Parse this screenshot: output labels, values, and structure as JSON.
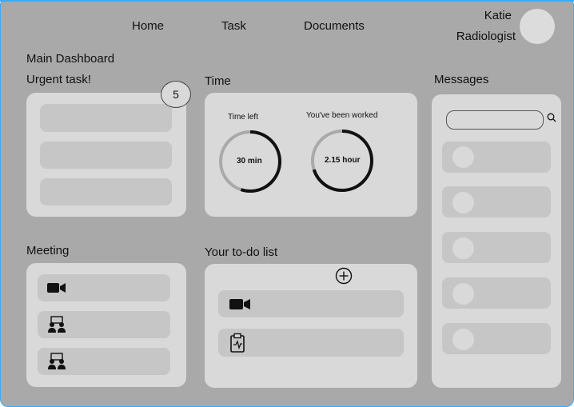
{
  "nav": {
    "home": "Home",
    "task": "Task",
    "documents": "Documents"
  },
  "user": {
    "name": "Katie",
    "role": "Radiologist"
  },
  "dashboard": {
    "title": "Main Dashboard"
  },
  "urgent": {
    "title": "Urgent task!",
    "count": "5",
    "items": [
      "",
      "",
      ""
    ]
  },
  "time": {
    "title": "Time",
    "left": {
      "label": "Time left",
      "value": "30 min",
      "progress": 0.55
    },
    "worked": {
      "label": "You've been worked",
      "value": "2.15 hour",
      "progress": 0.7
    }
  },
  "messages": {
    "title": "Messages",
    "search_placeholder": ""
  },
  "meeting": {
    "title": "Meeting",
    "items": [
      {
        "icon": "video-camera-icon"
      },
      {
        "icon": "meeting-people-icon"
      },
      {
        "icon": "meeting-people-icon"
      }
    ]
  },
  "todo": {
    "title": "Your to-do list",
    "items": [
      {
        "icon": "video-camera-icon"
      },
      {
        "icon": "clipboard-icon"
      }
    ]
  },
  "colors": {
    "background": "#a9a9a9",
    "card": "#d9d9d9",
    "bar": "#c6c6c6",
    "ring_track": "#a9a9a9",
    "ring_fill": "#111111",
    "border_highlight": "#3fa9f5"
  }
}
